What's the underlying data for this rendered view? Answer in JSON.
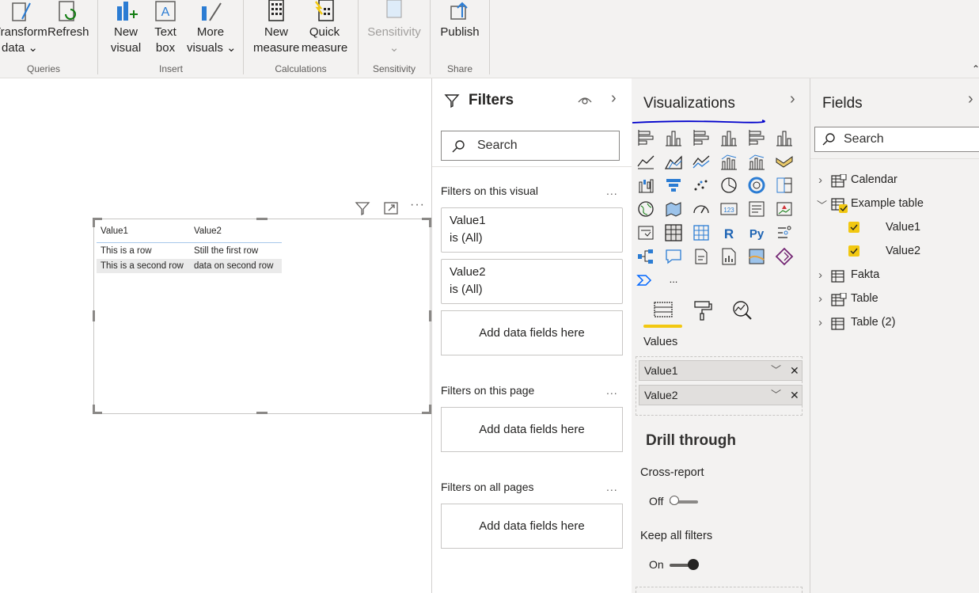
{
  "ribbon": {
    "buttons": [
      {
        "line1": "Transform",
        "line2": "data"
      },
      {
        "line1": "Refresh",
        "line2": ""
      },
      {
        "line1": "New",
        "line2": "visual"
      },
      {
        "line1": "Text",
        "line2": "box"
      },
      {
        "line1": "More",
        "line2": "visuals"
      },
      {
        "line1": "New",
        "line2": "measure"
      },
      {
        "line1": "Quick",
        "line2": "measure"
      },
      {
        "line1": "Sensitivity",
        "line2": ""
      },
      {
        "line1": "Publish",
        "line2": ""
      }
    ],
    "groups": [
      "Queries",
      "Insert",
      "Calculations",
      "Sensitivity",
      "Share"
    ]
  },
  "table_visual": {
    "headers": [
      "Value1",
      "Value2"
    ],
    "rows": [
      [
        "This is a row",
        "Still the first row"
      ],
      [
        "This is a second row",
        "data on second row"
      ]
    ]
  },
  "filters": {
    "title": "Filters",
    "search_placeholder": "Search",
    "on_visual_label": "Filters on this visual",
    "cards": [
      {
        "field": "Value1",
        "state": "is (All)"
      },
      {
        "field": "Value2",
        "state": "is (All)"
      }
    ],
    "add_fields": "Add data fields here",
    "on_page_label": "Filters on this page",
    "all_pages_label": "Filters on all pages",
    "more": "..."
  },
  "visualizations": {
    "title": "Visualizations",
    "values_label": "Values",
    "wells": [
      "Value1",
      "Value2"
    ],
    "drill_through_title": "Drill through",
    "cross_report_label": "Cross-report",
    "cross_report_state": "Off",
    "keep_filters_label": "Keep all filters",
    "keep_filters_state": "On",
    "r_label": "R",
    "py_label": "Py",
    "card_label": "123",
    "more": "..."
  },
  "fields": {
    "title": "Fields",
    "search_placeholder": "Search",
    "tables": [
      {
        "name": "Calendar"
      },
      {
        "name": "Example table",
        "columns": [
          "Value1",
          "Value2"
        ]
      },
      {
        "name": "Fakta"
      },
      {
        "name": "Table"
      },
      {
        "name": "Table (2)"
      }
    ]
  },
  "colors": {
    "accent_yellow": "#f2c811",
    "underline_blue": "#0000cc",
    "pane_bg": "#f3f2f1"
  }
}
